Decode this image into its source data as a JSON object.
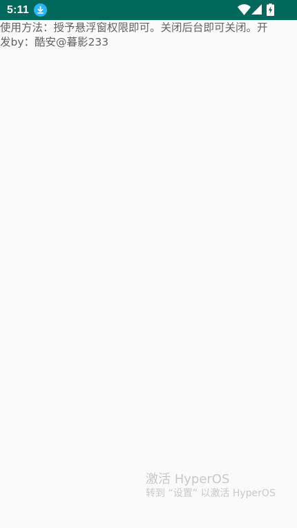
{
  "status_bar": {
    "time": "5:11",
    "background_color": "#00695c",
    "notification_icon": "download-icon",
    "notification_icon_color": "#29b6f6",
    "icons": [
      "wifi-icon",
      "cellular-signal-icon",
      "battery-charging-icon"
    ]
  },
  "content": {
    "instructions_line1": "使用方法：授予悬浮窗权限即可。关闭后台即可关闭。开",
    "instructions_line2": "发by：酷安@暮影233"
  },
  "watermark": {
    "title": "激活 HyperOS",
    "subtitle": "转到 “设置” 以激活 HyperOS"
  }
}
